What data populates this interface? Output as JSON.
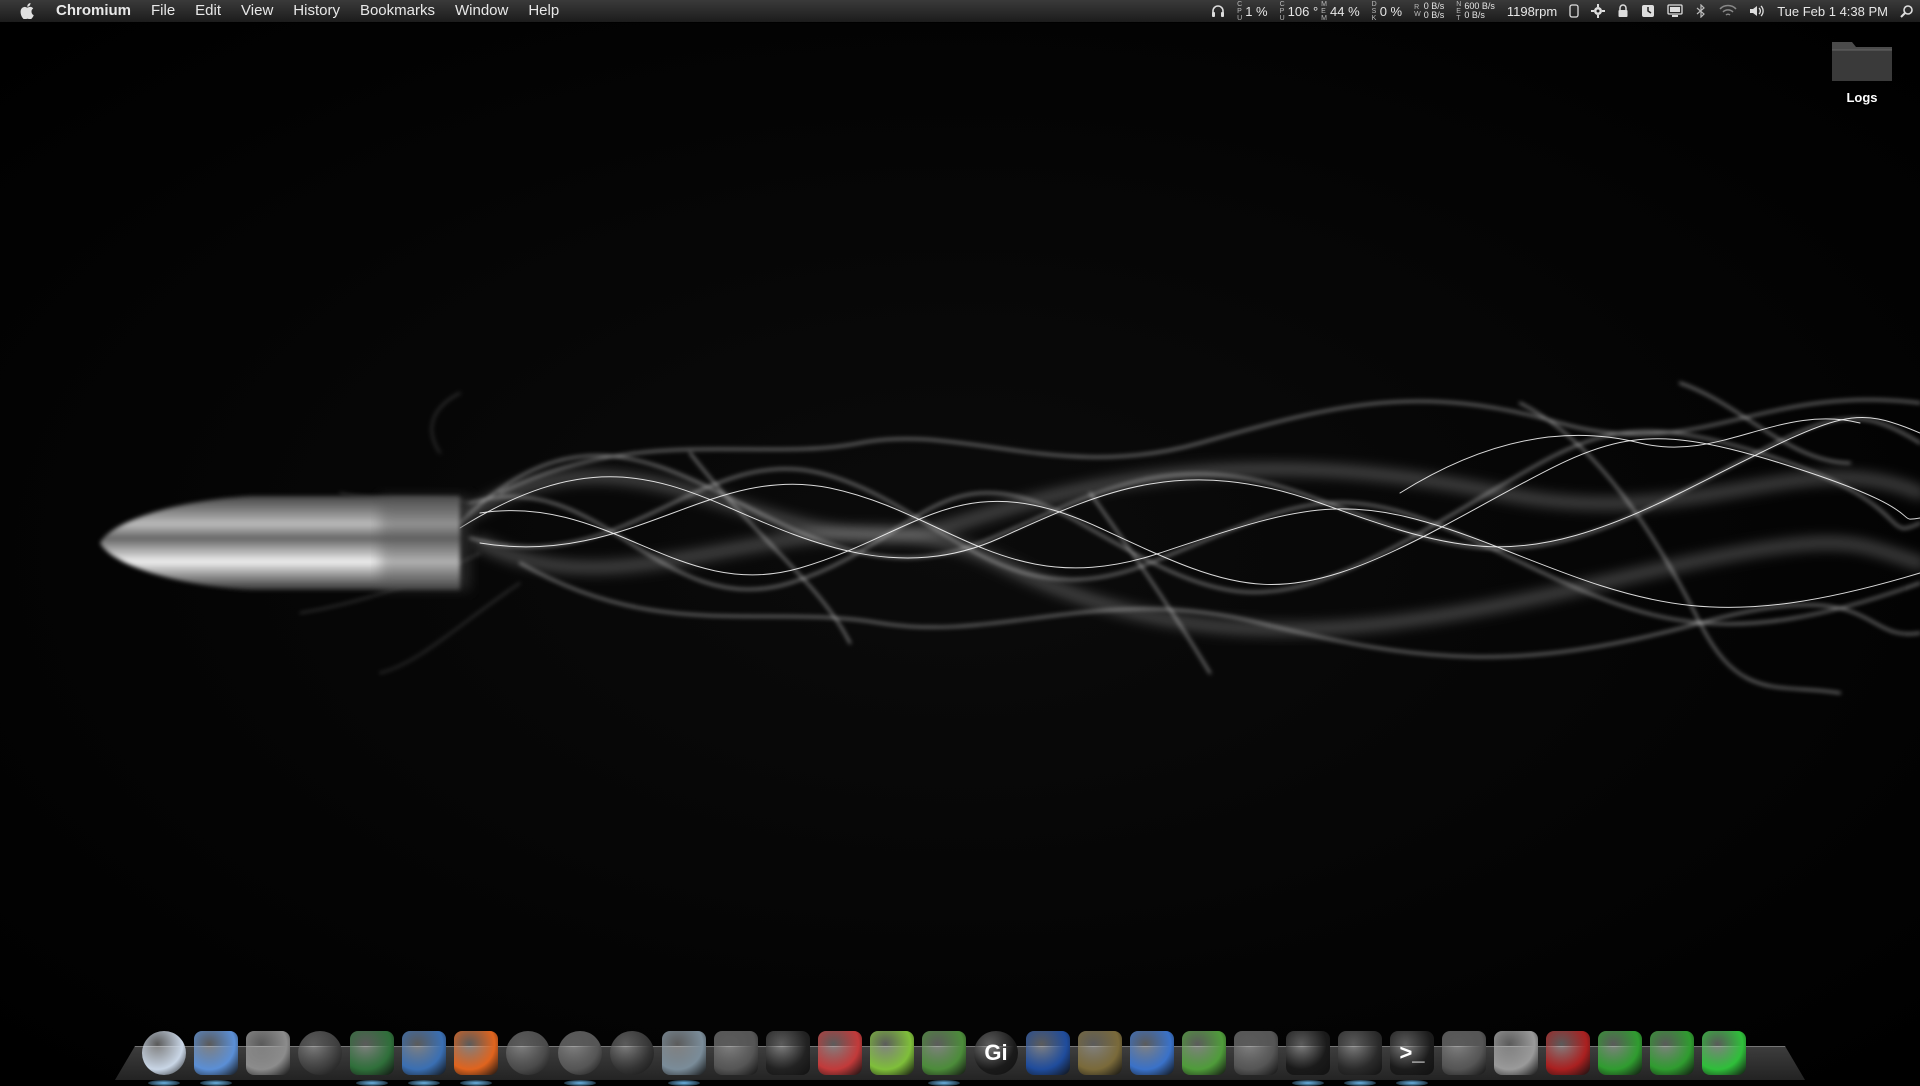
{
  "menubar": {
    "app_name": "Chromium",
    "menus": [
      "File",
      "Edit",
      "View",
      "History",
      "Bookmarks",
      "Window",
      "Help"
    ],
    "status": {
      "cpu1": "1 %",
      "temp": "106 °",
      "cpu2": "44 %",
      "disk": "0 %",
      "disk_rates": [
        "0 B/s",
        "0 B/s"
      ],
      "net_rates": [
        "600 B/s",
        "0 B/s"
      ],
      "fan": "1198rpm",
      "clock": "Tue Feb 1  4:38 PM"
    }
  },
  "desktop": {
    "icons": [
      {
        "label": "Logs",
        "icon": "folder-icon"
      }
    ]
  },
  "dock": {
    "items": [
      {
        "icon": "finder-icon",
        "color": "#c9d6e6"
      },
      {
        "icon": "finder-face-icon",
        "color": "#5b8fd6"
      },
      {
        "icon": "system-preferences-icon",
        "color": "#8c8c8c"
      },
      {
        "icon": "app-store-icon",
        "color": "#3d3d3d"
      },
      {
        "icon": "joystick-icon",
        "color": "#2f6f3a"
      },
      {
        "icon": "globe-eye-icon",
        "color": "#3a6fb3"
      },
      {
        "icon": "firefox-icon",
        "color": "#e0641e"
      },
      {
        "icon": "safari-icon",
        "color": "#4a4a4a"
      },
      {
        "icon": "itunes-icon",
        "color": "#555555"
      },
      {
        "icon": "speaker-icon",
        "color": "#333333"
      },
      {
        "icon": "preview-icon",
        "color": "#7a8c99"
      },
      {
        "icon": "twitter-icon",
        "color": "#555555"
      },
      {
        "icon": "adium-icon",
        "color": "#222222"
      },
      {
        "icon": "transmit-icon",
        "color": "#c23a3a"
      },
      {
        "icon": "download-icon",
        "color": "#7fbf3a"
      },
      {
        "icon": "world-icon",
        "color": "#4c8c3a"
      },
      {
        "icon": "gi-icon",
        "color": "#1a1a1a",
        "text": "Gi"
      },
      {
        "icon": "writer-icon",
        "color": "#1f4c9c"
      },
      {
        "icon": "monkey-icon",
        "color": "#7a6a3a"
      },
      {
        "icon": "xcode-icon",
        "color": "#3a72c9"
      },
      {
        "icon": "numbers-icon",
        "color": "#4f9c3a"
      },
      {
        "icon": "console-icon",
        "color": "#555555"
      },
      {
        "icon": "activity-monitor-icon",
        "color": "#1a1a1a"
      },
      {
        "icon": "activity-graph-icon",
        "color": "#2a2a2a"
      },
      {
        "icon": "terminal-icon",
        "color": "#1c1c1c",
        "text": ">_"
      },
      {
        "icon": "instruments-icon",
        "color": "#555555"
      },
      {
        "icon": "documents-icon",
        "color": "#9a9a9a"
      },
      {
        "icon": "clapper-icon",
        "color": "#aa2020"
      },
      {
        "icon": "sync-icon",
        "color": "#2f9c2f"
      },
      {
        "icon": "down-arrow-icon",
        "color": "#2f9c2f"
      },
      {
        "icon": "trash-icon",
        "color": "#2fbf3a"
      }
    ]
  }
}
